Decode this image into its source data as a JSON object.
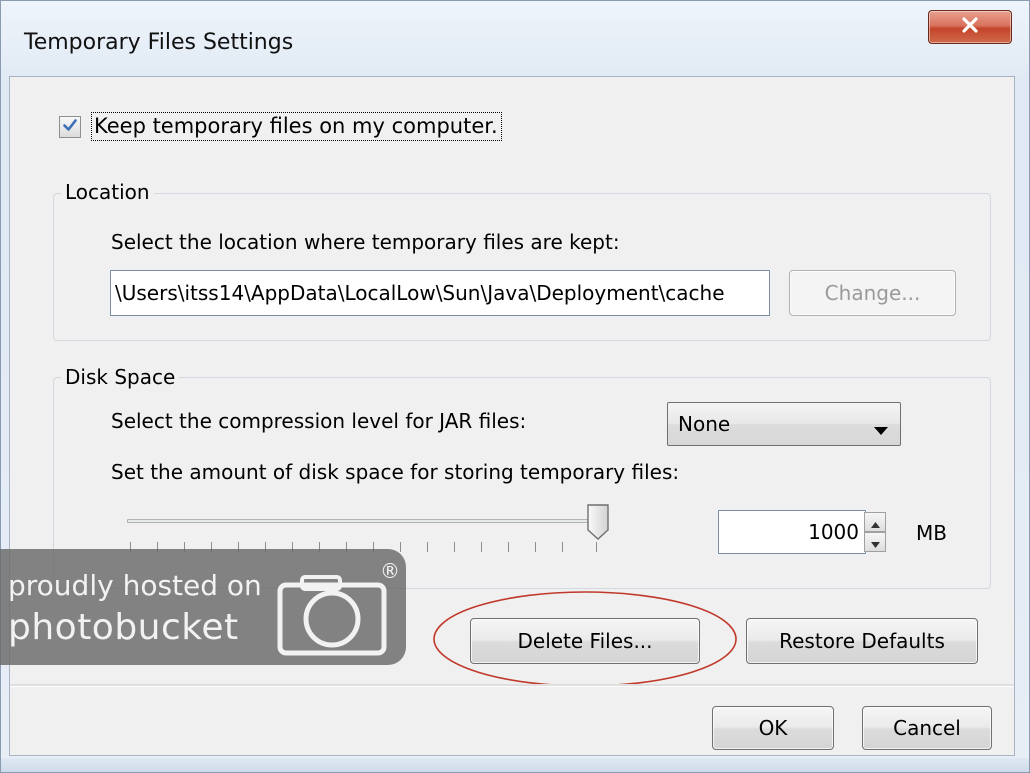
{
  "window": {
    "title": "Temporary Files Settings",
    "close_glyph": "x"
  },
  "keep_files": {
    "label": "Keep temporary files on my computer.",
    "checked": true
  },
  "location": {
    "legend": "Location",
    "prompt": "Select the location where temporary files are kept:",
    "path": "\\Users\\itss14\\AppData\\LocalLow\\Sun\\Java\\Deployment\\cache",
    "change_label": "Change..."
  },
  "disk_space": {
    "legend": "Disk Space",
    "compression_prompt": "Select the compression level for JAR files:",
    "compression_value": "None",
    "amount_prompt": "Set the amount of disk space for storing temporary files:",
    "amount_value": "1000",
    "unit": "MB",
    "slider_level_percent": 100
  },
  "actions": {
    "delete_label": "Delete Files...",
    "restore_label": "Restore Defaults"
  },
  "footer": {
    "ok_label": "OK",
    "cancel_label": "Cancel"
  },
  "watermark": {
    "line1": "proudly hosted on",
    "line2": "photobucket",
    "mark": "®"
  },
  "colors": {
    "close_button": "#c4442a",
    "annotation_ellipse": "#c0392b",
    "checkbox_tick": "#3d6fb4"
  },
  "icons": {
    "close": "close-icon",
    "checkmark": "checkmark-icon",
    "dropdown": "chevron-down-icon",
    "spin_up": "arrow-up-icon",
    "spin_down": "arrow-down-icon",
    "camera": "camera-icon"
  }
}
